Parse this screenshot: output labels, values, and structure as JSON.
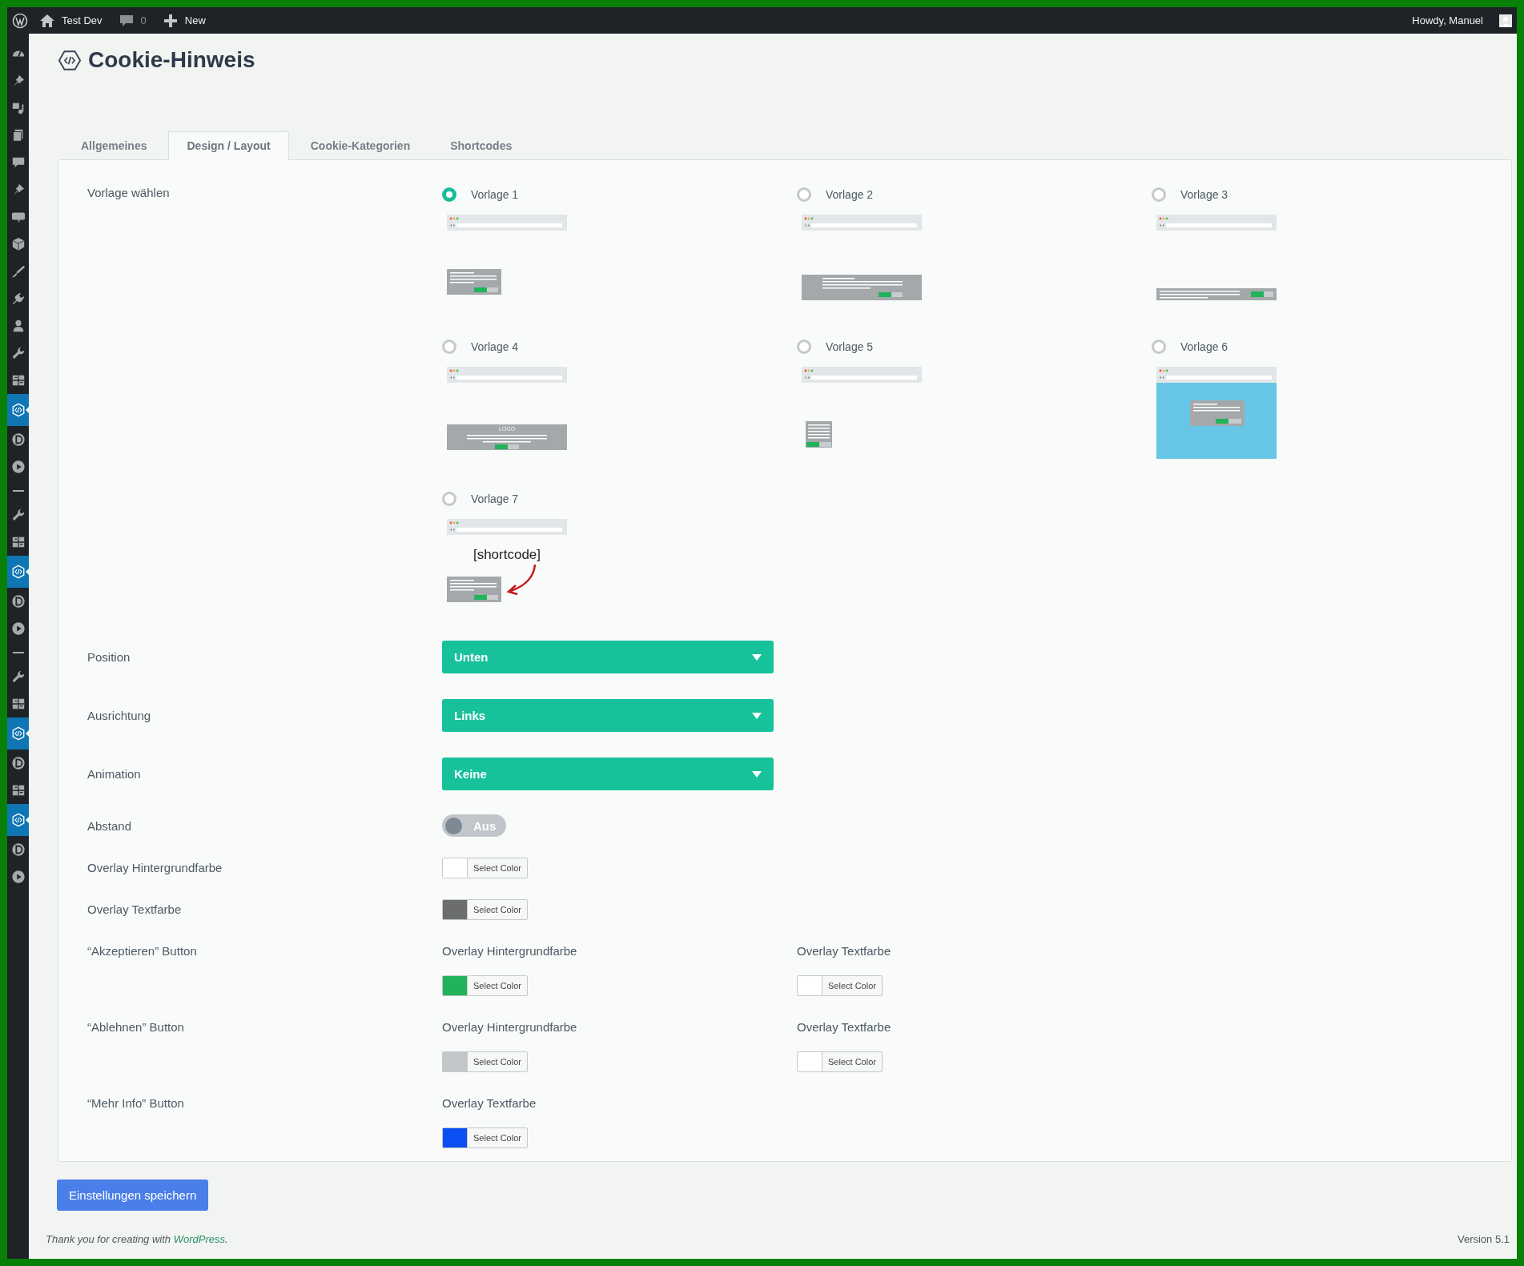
{
  "admin_bar": {
    "site": "Test Dev",
    "comments": "0",
    "new": "New",
    "greeting": "Howdy, Manuel"
  },
  "sidebar": {
    "items": [
      {
        "kind": "dashboard",
        "selected": false
      },
      {
        "kind": "pin",
        "selected": false
      },
      {
        "kind": "media",
        "selected": false
      },
      {
        "kind": "pages",
        "selected": false
      },
      {
        "kind": "comments",
        "selected": false
      },
      {
        "kind": "pin",
        "selected": false
      },
      {
        "kind": "woo",
        "selected": false
      },
      {
        "kind": "box",
        "selected": false
      },
      {
        "kind": "brush",
        "selected": false
      },
      {
        "kind": "plugin",
        "selected": false
      },
      {
        "kind": "user",
        "selected": false
      },
      {
        "kind": "wrench",
        "selected": false
      },
      {
        "kind": "grid",
        "selected": false
      },
      {
        "kind": "code",
        "selected": true
      },
      {
        "kind": "d",
        "selected": false
      },
      {
        "kind": "play",
        "selected": false
      },
      {
        "kind": "separator",
        "selected": false
      },
      {
        "kind": "wrench",
        "selected": false
      },
      {
        "kind": "grid",
        "selected": false
      },
      {
        "kind": "code",
        "selected": true
      },
      {
        "kind": "d",
        "selected": false
      },
      {
        "kind": "play",
        "selected": false
      },
      {
        "kind": "separator",
        "selected": false
      },
      {
        "kind": "wrench",
        "selected": false
      },
      {
        "kind": "grid",
        "selected": false
      },
      {
        "kind": "code",
        "selected": true
      },
      {
        "kind": "d",
        "selected": false
      },
      {
        "kind": "grid",
        "selected": false
      },
      {
        "kind": "code",
        "selected": true
      },
      {
        "kind": "d",
        "selected": false
      },
      {
        "kind": "play",
        "selected": false
      }
    ]
  },
  "page": {
    "title": "Cookie-Hinweis"
  },
  "tabs": [
    {
      "label": "Allgemeines",
      "selected": false
    },
    {
      "label": "Design / Layout",
      "selected": true
    },
    {
      "label": "Cookie-Kategorien",
      "selected": false
    },
    {
      "label": "Shortcodes",
      "selected": false
    }
  ],
  "template_field": {
    "label": "Vorlage wählen",
    "options": [
      {
        "label": "Vorlage 1",
        "selected": true,
        "kind": "box-left"
      },
      {
        "label": "Vorlage 2",
        "selected": false,
        "kind": "bar-wide"
      },
      {
        "label": "Vorlage 3",
        "selected": false,
        "kind": "bar-slim"
      },
      {
        "label": "Vorlage 4",
        "selected": false,
        "kind": "logo-bar",
        "logo_text": "LOGO"
      },
      {
        "label": "Vorlage 5",
        "selected": false,
        "kind": "small-box"
      },
      {
        "label": "Vorlage 6",
        "selected": false,
        "kind": "overlay"
      },
      {
        "label": "Vorlage 7",
        "selected": false,
        "kind": "shortcode",
        "note": "[shortcode]"
      }
    ]
  },
  "selects": [
    {
      "label": "Position",
      "value": "Unten"
    },
    {
      "label": "Ausrichtung",
      "value": "Links"
    },
    {
      "label": "Animation",
      "value": "Keine"
    }
  ],
  "toggle": {
    "label": "Abstand",
    "on": false,
    "text": "Aus"
  },
  "color_rows": [
    {
      "label": "Overlay Hintergrundfarbe",
      "pickers": [
        {
          "color": "#ffffff",
          "button": "Select Color"
        }
      ]
    },
    {
      "label": "Overlay Textfarbe",
      "pickers": [
        {
          "color": "#6b6e6b",
          "button": "Select Color"
        }
      ]
    },
    {
      "label": "“Akzeptieren” Button",
      "pickers": [
        {
          "caption": "Overlay Hintergrundfarbe",
          "color": "#21b25a",
          "button": "Select Color"
        },
        {
          "caption": "Overlay Textfarbe",
          "color": "#ffffff",
          "button": "Select Color"
        }
      ]
    },
    {
      "label": "“Ablehnen” Button",
      "pickers": [
        {
          "caption": "Overlay Hintergrundfarbe",
          "color": "#c3c7ca",
          "button": "Select Color"
        },
        {
          "caption": "Overlay Textfarbe",
          "color": "#ffffff",
          "button": "Select Color"
        }
      ]
    },
    {
      "label": "“Mehr Info” Button",
      "pickers": [
        {
          "caption": "Overlay Textfarbe",
          "color": "#0b4ff5",
          "button": "Select Color"
        }
      ]
    }
  ],
  "save_button": "Einstellungen speichern",
  "footer": {
    "text": "Thank you for creating with ",
    "link": "WordPress",
    "end": ".",
    "version": "Version 5.1"
  }
}
